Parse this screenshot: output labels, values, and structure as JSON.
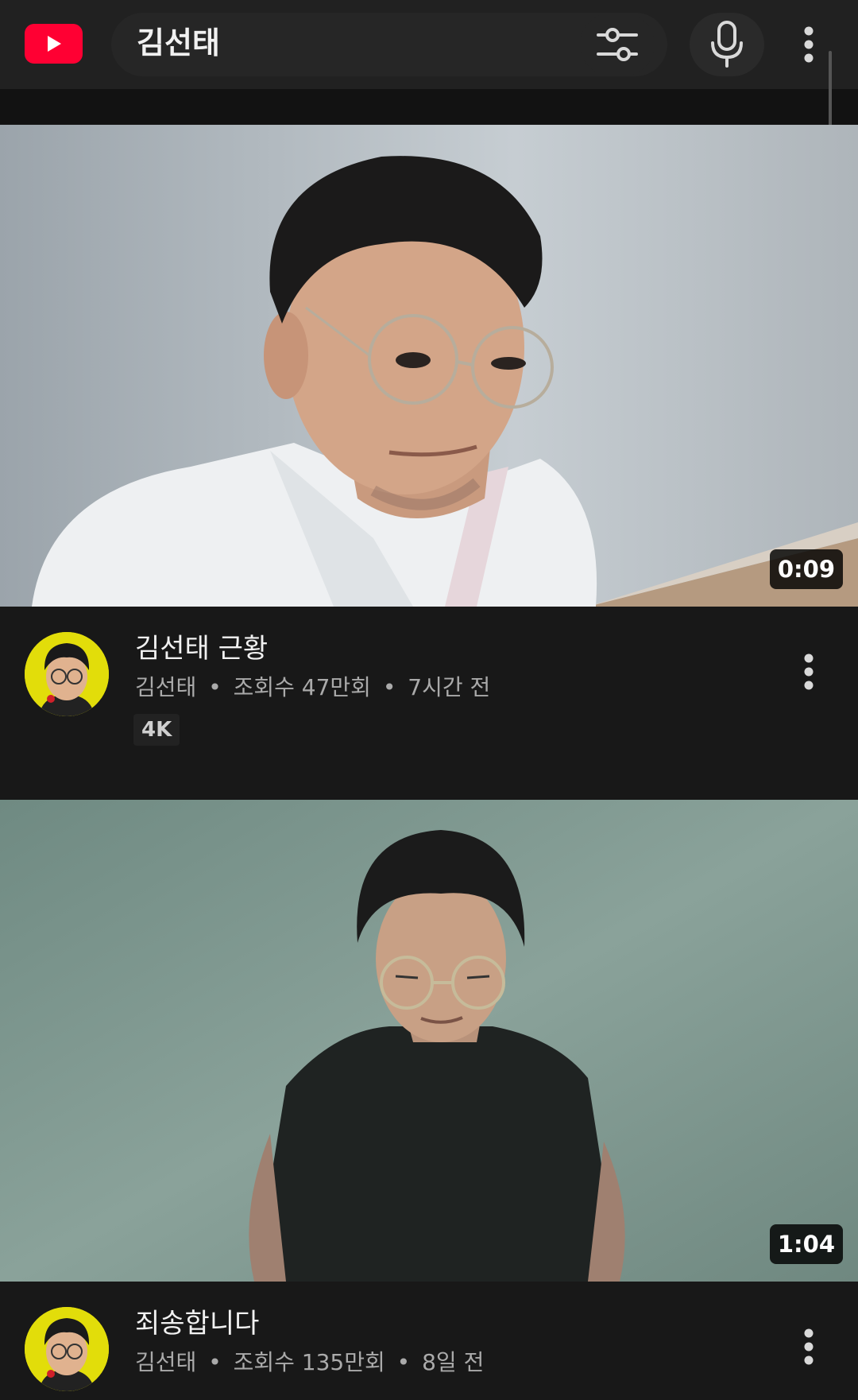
{
  "header": {
    "search_query": "김선태",
    "icons": {
      "logo": "youtube-logo",
      "filter": "tune-filter-icon",
      "mic": "microphone-icon",
      "more": "more-vert-icon"
    }
  },
  "videos": [
    {
      "title": "김선태 근황",
      "channel": "김선태",
      "views": "조회수 47만회",
      "age": "7시간 전",
      "badge": "4K",
      "duration": "0:09"
    },
    {
      "title": "죄송합니다",
      "channel": "김선태",
      "views": "조회수 135만회",
      "age": "8일 전",
      "duration": "1:04"
    }
  ],
  "separator": "•",
  "colors": {
    "background": "#181818",
    "header": "#212121",
    "accent": "#ff0033",
    "secondary_text": "#aaaaaa"
  }
}
